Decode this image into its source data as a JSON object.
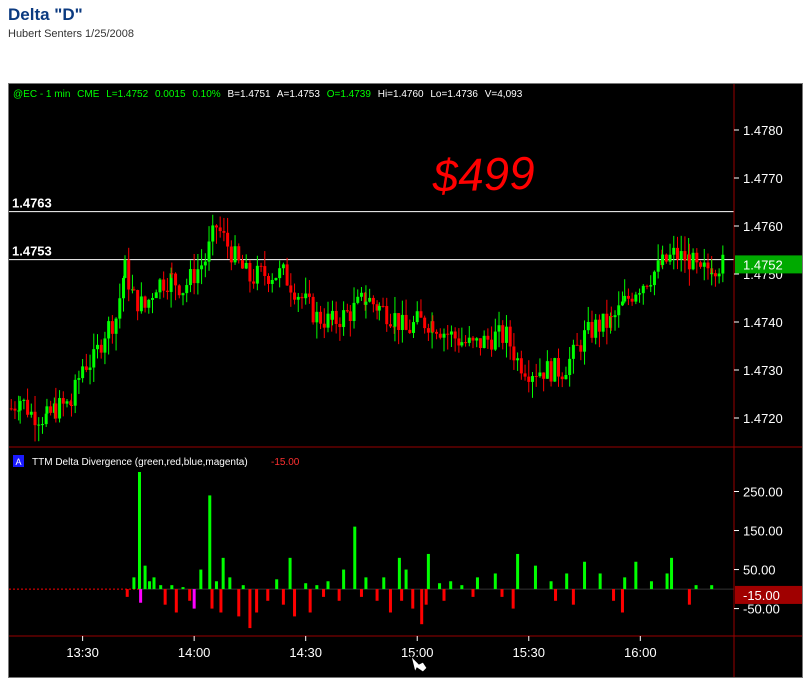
{
  "page": {
    "title": "Delta \"D\"",
    "subtitle": "Hubert Senters 1/25/2008"
  },
  "annotation": {
    "handwritten_text": "$499",
    "color": "#ff0000"
  },
  "colors": {
    "background": "#000000",
    "up_bar": "#00ff00",
    "down_bar": "#ff0000",
    "blue_bar": "#0000ff",
    "magenta_bar": "#ff00ff",
    "price_label_bg": "#00aa00",
    "indicator_value_bg": "#a00000",
    "axis_line": "#990000"
  },
  "chart_data": [
    {
      "type": "candlestick",
      "header": {
        "symbol": "@EC - 1 min",
        "exchange": "CME",
        "last": "L=1.4752",
        "change": "0.0015",
        "change_pct": "0.10%",
        "bid": "B=1.4751",
        "ask": "A=1.4753",
        "open": "O=1.4739",
        "high": "Hi=1.4760",
        "low": "Lo=1.4736",
        "volume": "V=4,093"
      },
      "ylim": [
        1.4715,
        1.4785
      ],
      "y_ticks": [
        "1.4780",
        "1.4770",
        "1.4760",
        "1.4750",
        "1.4740",
        "1.4730",
        "1.4720"
      ],
      "y_tick_values": [
        1.478,
        1.477,
        1.476,
        1.475,
        1.474,
        1.473,
        1.472
      ],
      "horizontal_lines": [
        {
          "label": "1.4763",
          "value": 1.4763
        },
        {
          "label": "1.4753",
          "value": 1.4753
        }
      ],
      "last_price_label": "1.4752",
      "last_price": 1.4752,
      "price_path": [
        {
          "t": 13.18,
          "p": 1.4722
        },
        {
          "t": 13.22,
          "p": 1.4724
        },
        {
          "t": 13.27,
          "p": 1.4721
        },
        {
          "t": 13.34,
          "p": 1.472
        },
        {
          "t": 13.38,
          "p": 1.4722
        },
        {
          "t": 13.45,
          "p": 1.4723
        },
        {
          "t": 13.5,
          "p": 1.4731
        },
        {
          "t": 13.55,
          "p": 1.4732
        },
        {
          "t": 13.6,
          "p": 1.4738
        },
        {
          "t": 13.65,
          "p": 1.4741
        },
        {
          "t": 13.69,
          "p": 1.4751
        },
        {
          "t": 13.73,
          "p": 1.4745
        },
        {
          "t": 13.78,
          "p": 1.4743
        },
        {
          "t": 13.83,
          "p": 1.4748
        },
        {
          "t": 13.9,
          "p": 1.4749
        },
        {
          "t": 13.95,
          "p": 1.4747
        },
        {
          "t": 14.05,
          "p": 1.4753
        },
        {
          "t": 14.1,
          "p": 1.476
        },
        {
          "t": 14.15,
          "p": 1.4756
        },
        {
          "t": 14.2,
          "p": 1.4752
        },
        {
          "t": 14.25,
          "p": 1.4749
        },
        {
          "t": 14.3,
          "p": 1.475
        },
        {
          "t": 14.4,
          "p": 1.475
        },
        {
          "t": 14.45,
          "p": 1.4747
        },
        {
          "t": 14.5,
          "p": 1.4744
        },
        {
          "t": 14.55,
          "p": 1.4741
        },
        {
          "t": 14.62,
          "p": 1.474
        },
        {
          "t": 14.7,
          "p": 1.4742
        },
        {
          "t": 14.77,
          "p": 1.4745
        },
        {
          "t": 14.83,
          "p": 1.4743
        },
        {
          "t": 14.9,
          "p": 1.4741
        },
        {
          "t": 14.95,
          "p": 1.4738
        },
        {
          "t": 15.0,
          "p": 1.474
        },
        {
          "t": 15.07,
          "p": 1.474
        },
        {
          "t": 15.12,
          "p": 1.4738
        },
        {
          "t": 15.2,
          "p": 1.4736
        },
        {
          "t": 15.25,
          "p": 1.4735
        },
        {
          "t": 15.3,
          "p": 1.4736
        },
        {
          "t": 15.35,
          "p": 1.4737
        },
        {
          "t": 15.4,
          "p": 1.4737
        },
        {
          "t": 15.45,
          "p": 1.4732
        },
        {
          "t": 15.5,
          "p": 1.473
        },
        {
          "t": 15.6,
          "p": 1.473
        },
        {
          "t": 15.65,
          "p": 1.473
        },
        {
          "t": 15.7,
          "p": 1.4733
        },
        {
          "t": 15.75,
          "p": 1.4737
        },
        {
          "t": 15.8,
          "p": 1.4739
        },
        {
          "t": 15.87,
          "p": 1.474
        },
        {
          "t": 15.93,
          "p": 1.4744
        },
        {
          "t": 15.98,
          "p": 1.4747
        },
        {
          "t": 16.03,
          "p": 1.4749
        },
        {
          "t": 16.1,
          "p": 1.4752
        },
        {
          "t": 16.15,
          "p": 1.4754
        },
        {
          "t": 16.22,
          "p": 1.4753
        },
        {
          "t": 16.27,
          "p": 1.475
        },
        {
          "t": 16.32,
          "p": 1.4752
        },
        {
          "t": 16.38,
          "p": 1.4752
        }
      ],
      "x_ticks": [
        "13:30",
        "14:00",
        "14:30",
        "15:00",
        "15:30",
        "16:00"
      ],
      "x_tick_values": [
        13.5,
        14.0,
        14.5,
        15.0,
        15.5,
        16.0
      ],
      "xlim": [
        13.17,
        16.42
      ]
    },
    {
      "type": "bar",
      "title": "TTM Delta Divergence (green,red,blue,magenta)",
      "marker_label": "A",
      "current_value_label": "-15.00",
      "current_value": -15,
      "ylim": [
        -110,
        300
      ],
      "y_ticks": [
        "250.00",
        "150.00",
        "50.00",
        "-50.00"
      ],
      "y_tick_values": [
        250,
        150,
        50,
        -50
      ],
      "series": [
        {
          "name": "green",
          "points": [
            {
              "t": 13.73,
              "v": 30
            },
            {
              "t": 13.755,
              "v": 300
            },
            {
              "t": 13.78,
              "v": 60
            },
            {
              "t": 13.8,
              "v": 20
            },
            {
              "t": 13.82,
              "v": 30
            },
            {
              "t": 13.85,
              "v": 10
            },
            {
              "t": 13.9,
              "v": 10
            },
            {
              "t": 13.95,
              "v": 5
            },
            {
              "t": 14.03,
              "v": 50
            },
            {
              "t": 14.07,
              "v": 240
            },
            {
              "t": 14.1,
              "v": 20
            },
            {
              "t": 14.13,
              "v": 80
            },
            {
              "t": 14.16,
              "v": 30
            },
            {
              "t": 14.22,
              "v": 10
            },
            {
              "t": 14.37,
              "v": 25
            },
            {
              "t": 14.43,
              "v": 80
            },
            {
              "t": 14.5,
              "v": 15
            },
            {
              "t": 14.55,
              "v": 10
            },
            {
              "t": 14.6,
              "v": 20
            },
            {
              "t": 14.67,
              "v": 50
            },
            {
              "t": 14.72,
              "v": 160
            },
            {
              "t": 14.77,
              "v": 30
            },
            {
              "t": 14.85,
              "v": 30
            },
            {
              "t": 14.92,
              "v": 80
            },
            {
              "t": 14.95,
              "v": 50
            },
            {
              "t": 15.05,
              "v": 90
            },
            {
              "t": 15.1,
              "v": 15
            },
            {
              "t": 15.15,
              "v": 20
            },
            {
              "t": 15.2,
              "v": 10
            },
            {
              "t": 15.27,
              "v": 30
            },
            {
              "t": 15.35,
              "v": 40
            },
            {
              "t": 15.45,
              "v": 90
            },
            {
              "t": 15.53,
              "v": 60
            },
            {
              "t": 15.6,
              "v": 20
            },
            {
              "t": 15.67,
              "v": 40
            },
            {
              "t": 15.75,
              "v": 70
            },
            {
              "t": 15.82,
              "v": 40
            },
            {
              "t": 15.93,
              "v": 30
            },
            {
              "t": 15.98,
              "v": 70
            },
            {
              "t": 16.05,
              "v": 20
            },
            {
              "t": 16.12,
              "v": 40
            },
            {
              "t": 16.14,
              "v": 80
            },
            {
              "t": 16.25,
              "v": 10
            },
            {
              "t": 16.32,
              "v": 10
            }
          ]
        },
        {
          "name": "red",
          "points": [
            {
              "t": 13.7,
              "v": -20
            },
            {
              "t": 13.87,
              "v": -40
            },
            {
              "t": 13.92,
              "v": -60
            },
            {
              "t": 13.98,
              "v": -30
            },
            {
              "t": 14.08,
              "v": -50
            },
            {
              "t": 14.12,
              "v": -60
            },
            {
              "t": 14.2,
              "v": -70
            },
            {
              "t": 14.25,
              "v": -100
            },
            {
              "t": 14.28,
              "v": -60
            },
            {
              "t": 14.33,
              "v": -30
            },
            {
              "t": 14.4,
              "v": -40
            },
            {
              "t": 14.45,
              "v": -70
            },
            {
              "t": 14.52,
              "v": -60
            },
            {
              "t": 14.58,
              "v": -20
            },
            {
              "t": 14.65,
              "v": -30
            },
            {
              "t": 14.75,
              "v": -20
            },
            {
              "t": 14.82,
              "v": -30
            },
            {
              "t": 14.88,
              "v": -60
            },
            {
              "t": 14.93,
              "v": -30
            },
            {
              "t": 14.98,
              "v": -50
            },
            {
              "t": 15.02,
              "v": -90
            },
            {
              "t": 15.04,
              "v": -40
            },
            {
              "t": 15.12,
              "v": -30
            },
            {
              "t": 15.25,
              "v": -20
            },
            {
              "t": 15.38,
              "v": -20
            },
            {
              "t": 15.43,
              "v": -50
            },
            {
              "t": 15.62,
              "v": -30
            },
            {
              "t": 15.7,
              "v": -40
            },
            {
              "t": 15.88,
              "v": -30
            },
            {
              "t": 15.92,
              "v": -60
            },
            {
              "t": 16.22,
              "v": -40
            }
          ]
        },
        {
          "name": "magenta",
          "points": [
            {
              "t": 13.76,
              "v": -35
            },
            {
              "t": 14.0,
              "v": -50
            }
          ]
        }
      ],
      "x_ticks": [
        "13:30",
        "14:00",
        "14:30",
        "15:00",
        "15:30",
        "16:00"
      ],
      "x_tick_values": [
        13.5,
        14.0,
        14.5,
        15.0,
        15.5,
        16.0
      ],
      "xlim": [
        13.17,
        16.42
      ]
    }
  ]
}
